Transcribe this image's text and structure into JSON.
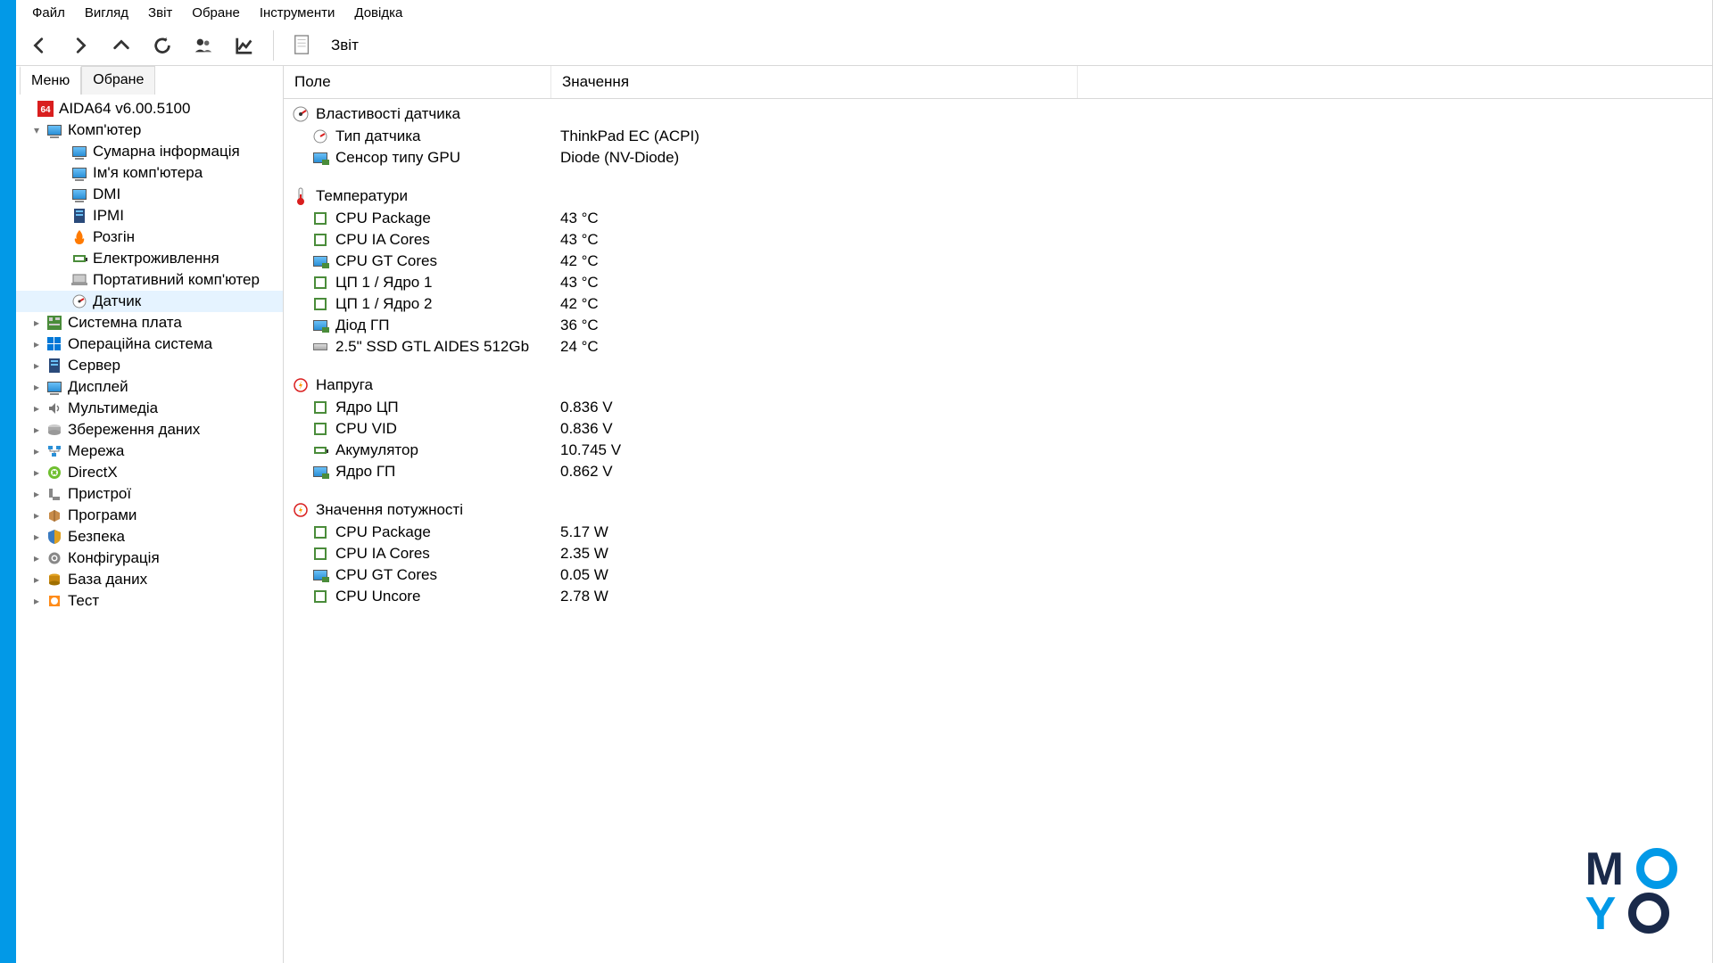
{
  "menubar": [
    "Файл",
    "Вигляд",
    "Звіт",
    "Обране",
    "Інструменти",
    "Довідка"
  ],
  "toolbar": {
    "report": "Звіт"
  },
  "left_tabs": {
    "menu": "Меню",
    "fav": "Обране"
  },
  "tree": {
    "root": "AIDA64 v6.00.5100",
    "computer": "Комп'ютер",
    "computer_children": [
      "Сумарна інформація",
      "Ім'я комп'ютера",
      "DMI",
      "IPMI",
      "Розгін",
      "Електроживлення",
      "Портативний комп'ютер",
      "Датчик"
    ],
    "others": [
      "Системна плата",
      "Операційна система",
      "Сервер",
      "Дисплей",
      "Мультимедіа",
      "Збереження даних",
      "Мережа",
      "DirectX",
      "Пристрої",
      "Програми",
      "Безпека",
      "Конфігурація",
      "База даних",
      "Тест"
    ]
  },
  "columns": {
    "field": "Поле",
    "value": "Значення"
  },
  "sections": {
    "sensor_props": {
      "title": "Властивості датчика",
      "rows": [
        {
          "f": "Тип датчика",
          "v": "ThinkPad EC  (ACPI)"
        },
        {
          "f": "Сенсор типу GPU",
          "v": "Diode  (NV-Diode)"
        }
      ]
    },
    "temperatures": {
      "title": "Температури",
      "rows": [
        {
          "f": "CPU Package",
          "v": "43 °C"
        },
        {
          "f": "CPU IA Cores",
          "v": "43 °C"
        },
        {
          "f": "CPU GT Cores",
          "v": "42 °C"
        },
        {
          "f": "ЦП 1 / Ядро 1",
          "v": "43 °C"
        },
        {
          "f": "ЦП 1 / Ядро 2",
          "v": "42 °C"
        },
        {
          "f": "Діод ГП",
          "v": "36 °C"
        },
        {
          "f": "2.5\" SSD GTL AIDES 512Gb",
          "v": "24 °C"
        }
      ]
    },
    "voltages": {
      "title": "Напруга",
      "rows": [
        {
          "f": "Ядро ЦП",
          "v": "0.836 V"
        },
        {
          "f": "CPU VID",
          "v": "0.836 V"
        },
        {
          "f": "Акумулятор",
          "v": "10.745 V"
        },
        {
          "f": "Ядро ГП",
          "v": "0.862 V"
        }
      ]
    },
    "power": {
      "title": "Значення потужності",
      "rows": [
        {
          "f": "CPU Package",
          "v": "5.17 W"
        },
        {
          "f": "CPU IA Cores",
          "v": "2.35 W"
        },
        {
          "f": "CPU GT Cores",
          "v": "0.05 W"
        },
        {
          "f": "CPU Uncore",
          "v": "2.78 W"
        }
      ]
    }
  }
}
